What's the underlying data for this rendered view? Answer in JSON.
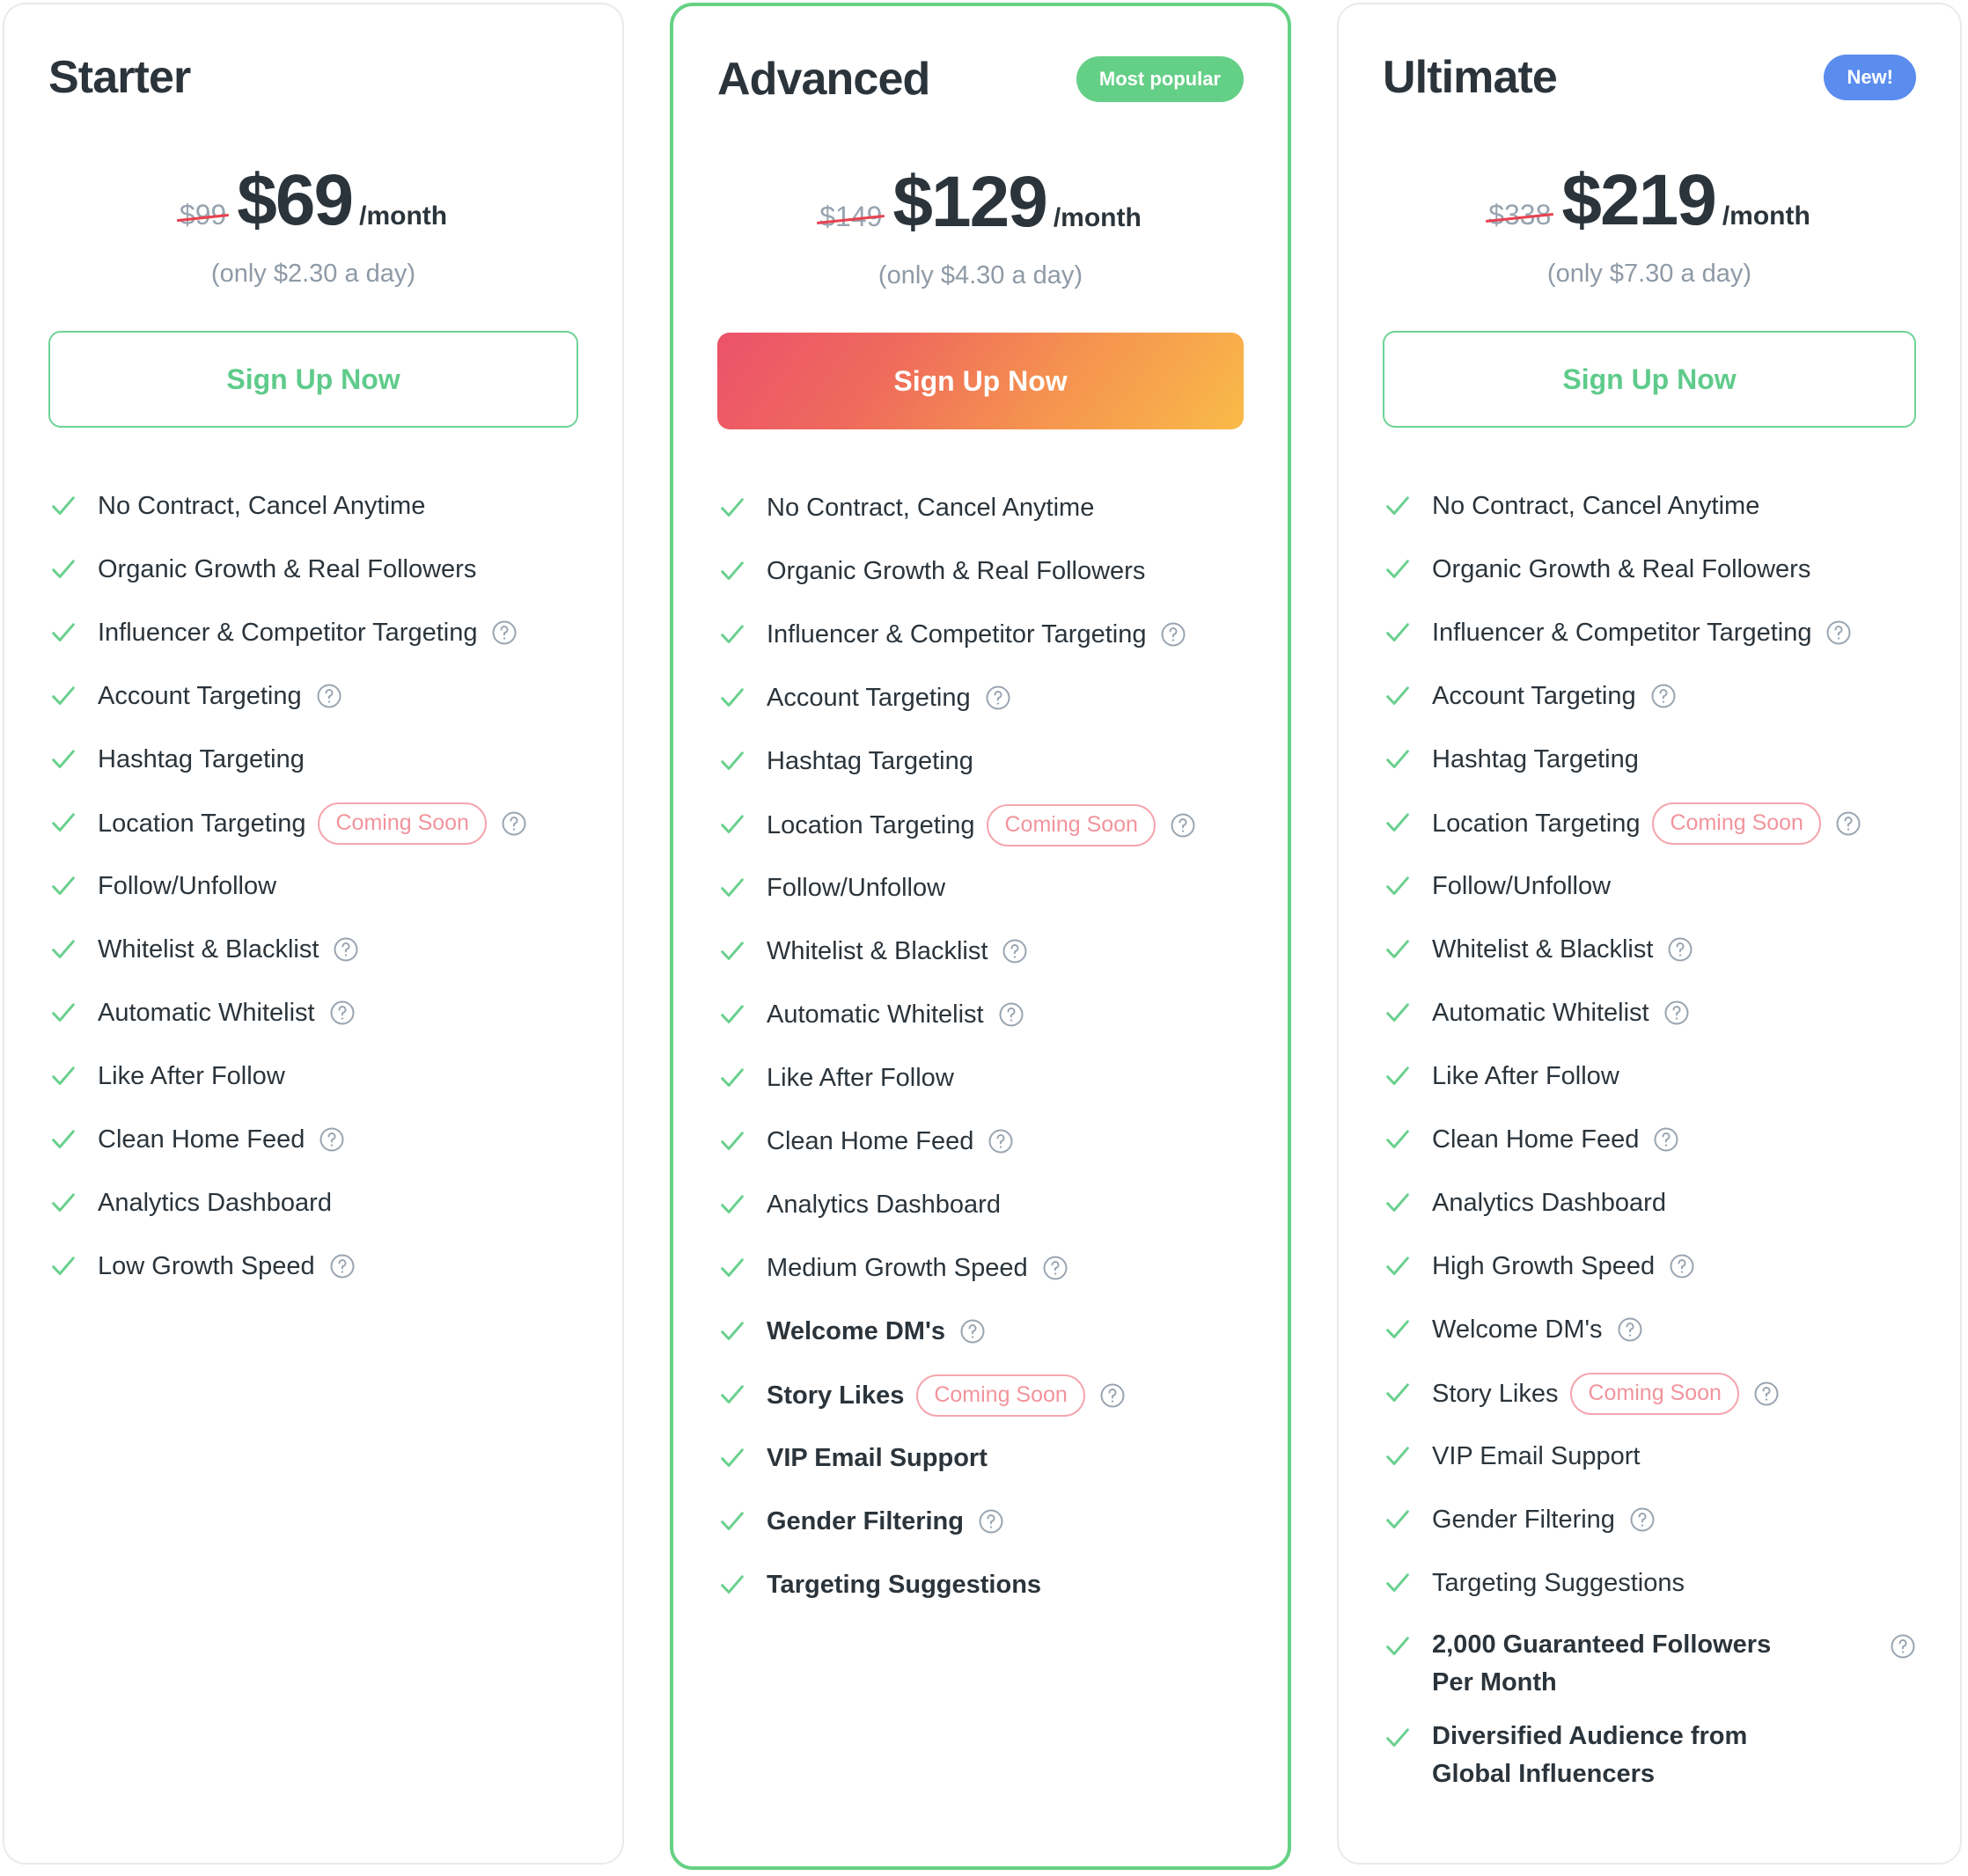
{
  "icons": {
    "check": "check-icon",
    "help": "help-circle-icon"
  },
  "colors": {
    "brand_green": "#64cf87",
    "accent_blue": "#5b8def",
    "coming_soon_pink": "#f2949d",
    "text_dark": "#2b343b",
    "text_muted": "#8e9aa6",
    "strike_red": "#e8414f",
    "cta_gradient_start": "#ec526b",
    "cta_gradient_end": "#f9bb48"
  },
  "labels": {
    "coming_soon": "Coming Soon",
    "per_month_suffix": "/month"
  },
  "plans": [
    {
      "id": "starter",
      "name": "Starter",
      "badge": null,
      "badge_type": null,
      "old_price": "$99",
      "price": "$69",
      "per_month": "/month",
      "per_day": "(only $2.30 a day)",
      "cta_label": "Sign Up Now",
      "cta_style": "outline",
      "features": [
        {
          "label": "No Contract, Cancel Anytime",
          "help": false,
          "soon": false,
          "bold": false
        },
        {
          "label": "Organic Growth & Real Followers",
          "help": false,
          "soon": false,
          "bold": false
        },
        {
          "label": "Influencer & Competitor Targeting",
          "help": true,
          "soon": false,
          "bold": false
        },
        {
          "label": "Account Targeting",
          "help": true,
          "soon": false,
          "bold": false
        },
        {
          "label": "Hashtag Targeting",
          "help": false,
          "soon": false,
          "bold": false
        },
        {
          "label": "Location Targeting",
          "help": true,
          "soon": true,
          "bold": false
        },
        {
          "label": "Follow/Unfollow",
          "help": false,
          "soon": false,
          "bold": false
        },
        {
          "label": "Whitelist & Blacklist",
          "help": true,
          "soon": false,
          "bold": false
        },
        {
          "label": "Automatic Whitelist",
          "help": true,
          "soon": false,
          "bold": false
        },
        {
          "label": "Like After Follow",
          "help": false,
          "soon": false,
          "bold": false
        },
        {
          "label": "Clean Home Feed",
          "help": true,
          "soon": false,
          "bold": false
        },
        {
          "label": "Analytics Dashboard",
          "help": false,
          "soon": false,
          "bold": false
        },
        {
          "label": "Low Growth Speed",
          "help": true,
          "soon": false,
          "bold": false
        }
      ]
    },
    {
      "id": "advanced",
      "name": "Advanced",
      "badge": "Most popular",
      "badge_type": "popular",
      "old_price": "$149",
      "price": "$129",
      "per_month": "/month",
      "per_day": "(only $4.30 a day)",
      "cta_label": "Sign Up Now",
      "cta_style": "gradient",
      "features": [
        {
          "label": "No Contract, Cancel Anytime",
          "help": false,
          "soon": false,
          "bold": false
        },
        {
          "label": "Organic Growth & Real Followers",
          "help": false,
          "soon": false,
          "bold": false
        },
        {
          "label": "Influencer & Competitor Targeting",
          "help": true,
          "soon": false,
          "bold": false
        },
        {
          "label": "Account Targeting",
          "help": true,
          "soon": false,
          "bold": false
        },
        {
          "label": "Hashtag Targeting",
          "help": false,
          "soon": false,
          "bold": false
        },
        {
          "label": "Location Targeting",
          "help": true,
          "soon": true,
          "bold": false
        },
        {
          "label": "Follow/Unfollow",
          "help": false,
          "soon": false,
          "bold": false
        },
        {
          "label": "Whitelist & Blacklist",
          "help": true,
          "soon": false,
          "bold": false
        },
        {
          "label": "Automatic Whitelist",
          "help": true,
          "soon": false,
          "bold": false
        },
        {
          "label": "Like After Follow",
          "help": false,
          "soon": false,
          "bold": false
        },
        {
          "label": "Clean Home Feed",
          "help": true,
          "soon": false,
          "bold": false
        },
        {
          "label": "Analytics Dashboard",
          "help": false,
          "soon": false,
          "bold": false
        },
        {
          "label": "Medium Growth Speed",
          "help": true,
          "soon": false,
          "bold": false
        },
        {
          "label": "Welcome DM's",
          "help": true,
          "soon": false,
          "bold": true
        },
        {
          "label": "Story Likes",
          "help": true,
          "soon": true,
          "bold": true
        },
        {
          "label": "VIP Email Support",
          "help": false,
          "soon": false,
          "bold": true
        },
        {
          "label": "Gender Filtering",
          "help": true,
          "soon": false,
          "bold": true
        },
        {
          "label": "Targeting Suggestions",
          "help": false,
          "soon": false,
          "bold": true
        }
      ]
    },
    {
      "id": "ultimate",
      "name": "Ultimate",
      "badge": "New!",
      "badge_type": "new",
      "old_price": "$338",
      "price": "$219",
      "per_month": "/month",
      "per_day": "(only $7.30 a day)",
      "cta_label": "Sign Up Now",
      "cta_style": "outline",
      "features": [
        {
          "label": "No Contract, Cancel Anytime",
          "help": false,
          "soon": false,
          "bold": false
        },
        {
          "label": "Organic Growth & Real Followers",
          "help": false,
          "soon": false,
          "bold": false
        },
        {
          "label": "Influencer & Competitor Targeting",
          "help": true,
          "soon": false,
          "bold": false
        },
        {
          "label": "Account Targeting",
          "help": true,
          "soon": false,
          "bold": false
        },
        {
          "label": "Hashtag Targeting",
          "help": false,
          "soon": false,
          "bold": false
        },
        {
          "label": "Location Targeting",
          "help": true,
          "soon": true,
          "bold": false
        },
        {
          "label": "Follow/Unfollow",
          "help": false,
          "soon": false,
          "bold": false
        },
        {
          "label": "Whitelist & Blacklist",
          "help": true,
          "soon": false,
          "bold": false
        },
        {
          "label": "Automatic Whitelist",
          "help": true,
          "soon": false,
          "bold": false
        },
        {
          "label": "Like After Follow",
          "help": false,
          "soon": false,
          "bold": false
        },
        {
          "label": "Clean Home Feed",
          "help": true,
          "soon": false,
          "bold": false
        },
        {
          "label": "Analytics Dashboard",
          "help": false,
          "soon": false,
          "bold": false
        },
        {
          "label": "High Growth Speed",
          "help": true,
          "soon": false,
          "bold": false
        },
        {
          "label": "Welcome DM's",
          "help": true,
          "soon": false,
          "bold": false
        },
        {
          "label": "Story Likes",
          "help": true,
          "soon": true,
          "bold": false
        },
        {
          "label": "VIP Email Support",
          "help": false,
          "soon": false,
          "bold": false
        },
        {
          "label": "Gender Filtering",
          "help": true,
          "soon": false,
          "bold": false
        },
        {
          "label": "Targeting Suggestions",
          "help": false,
          "soon": false,
          "bold": false
        },
        {
          "label": "2,000 Guaranteed Followers Per Month",
          "help": true,
          "help_trailing": true,
          "soon": false,
          "bold": true,
          "wrap": true
        },
        {
          "label": "Diversified Audience from Global Influencers",
          "help": false,
          "soon": false,
          "bold": true,
          "wrap": true
        }
      ]
    }
  ]
}
